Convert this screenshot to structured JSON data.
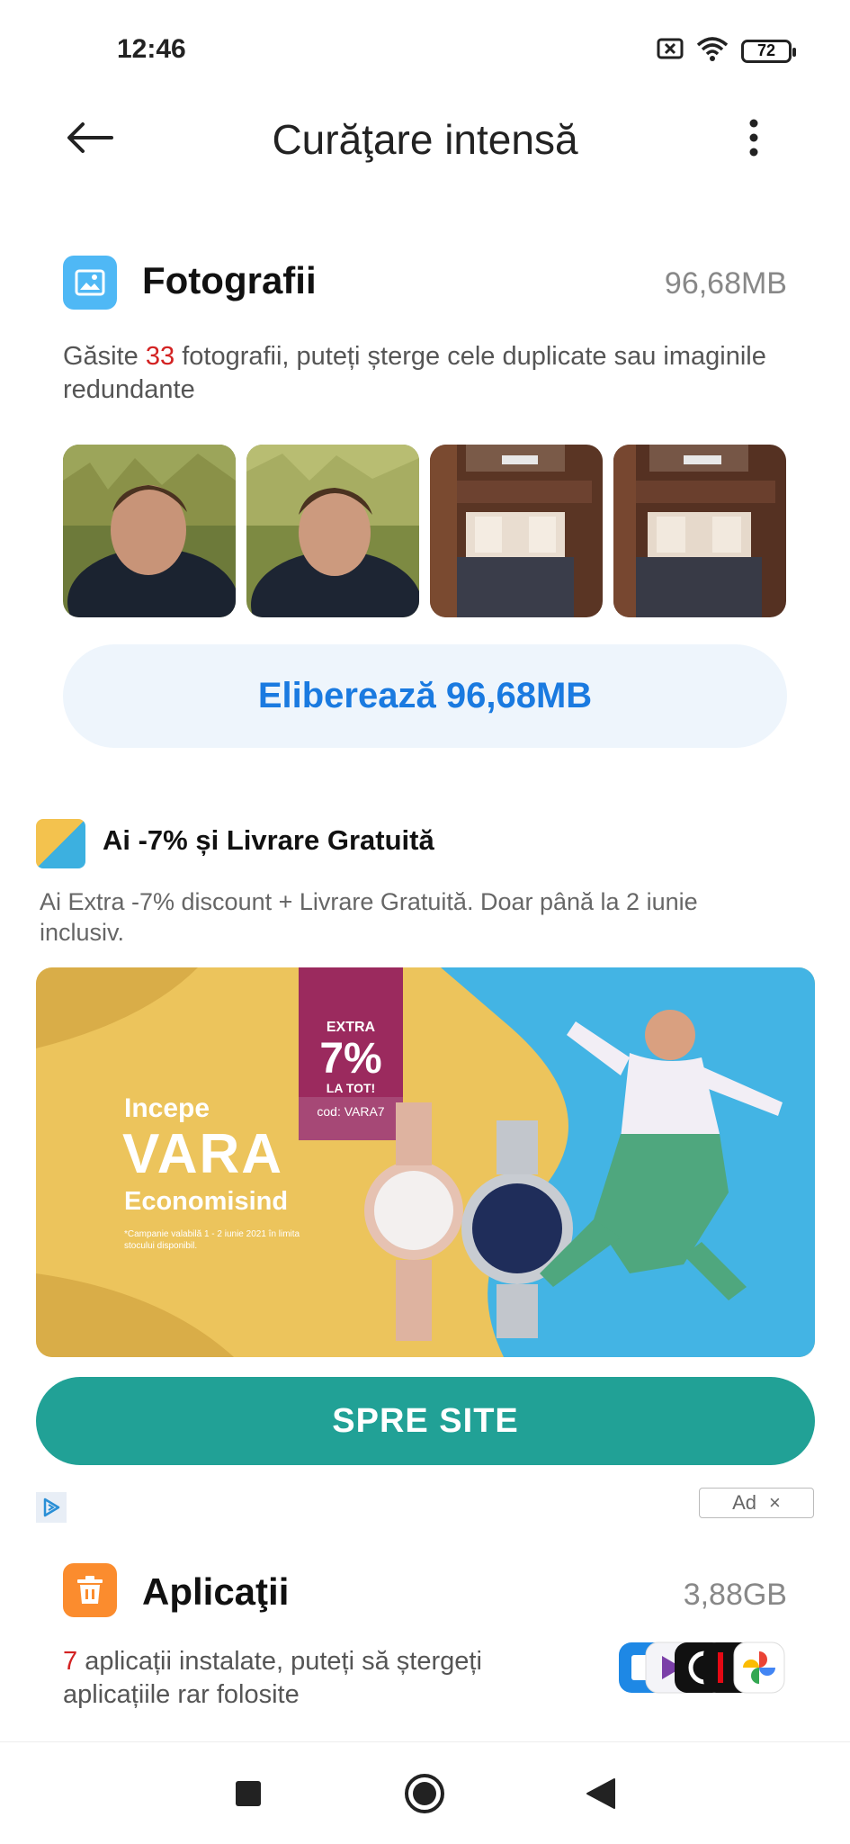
{
  "status_bar": {
    "time": "12:46",
    "battery": "72"
  },
  "header": {
    "title": "Curăţare intensă"
  },
  "photos": {
    "title": "Fotografii",
    "size": "96,68MB",
    "desc_prefix": "Găsite ",
    "count": "33",
    "desc_suffix": " fotografii, puteți șterge cele duplicate sau imaginile redundante",
    "free_button": "Eliberează 96,68MB"
  },
  "ad": {
    "title": "Ai -7% și Livrare Gratuită",
    "description": "Ai Extra -7% discount + Livrare Gratuită. Doar până la 2 iunie inclusiv.",
    "banner": {
      "line1": "Incepe",
      "line2": "VARA",
      "line3": "Economisind",
      "fine_print": "*Campanie valabilă 1 - 2 iunie 2021 în limita stocului disponibil.",
      "badge_top": "EXTRA",
      "badge_pct": "7%",
      "badge_bottom": "LA TOT!",
      "code": "cod: VARA7"
    },
    "cta": "SPRE SITE",
    "tag": "Ad",
    "tag_close": "×"
  },
  "apps": {
    "title": "Aplicaţii",
    "size": "3,88GB",
    "count": "7",
    "desc_suffix": " aplicații instalate, puteți să ștergeți aplicațiile rar folosite"
  },
  "colors": {
    "accent_blue": "#1a7ae0",
    "teal": "#21a196",
    "photo_icon": "#4fb8f5",
    "apps_icon": "#fb8c2e",
    "count_red": "#d32222"
  }
}
